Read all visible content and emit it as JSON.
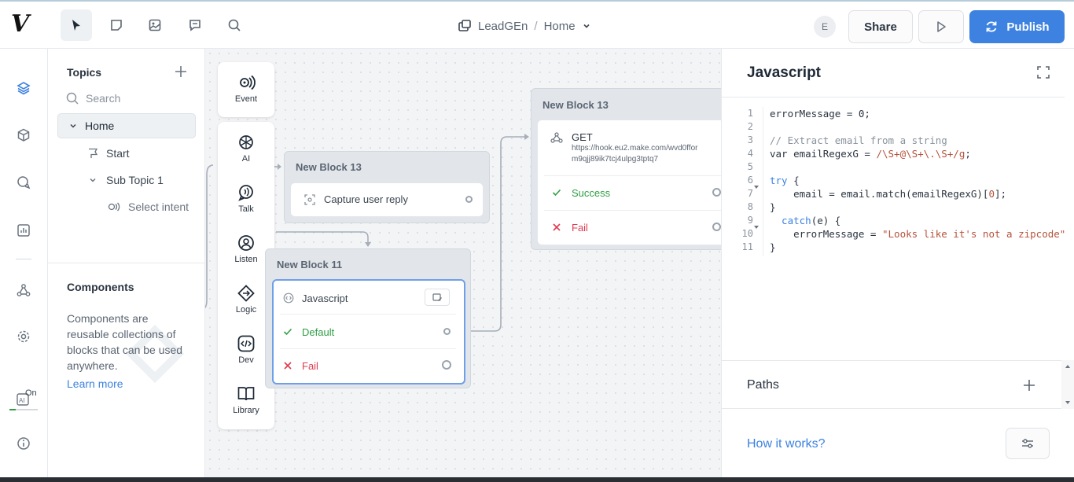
{
  "app": {
    "logo_text": "V"
  },
  "header": {
    "project": "LeadGEn",
    "separator": "/",
    "page": "Home",
    "avatar_initial": "E",
    "share_label": "Share",
    "publish_label": "Publish"
  },
  "rail": {
    "ai_toggle_label": "On"
  },
  "topics": {
    "title": "Topics",
    "search_placeholder": "Search",
    "items": [
      {
        "label": "Home"
      },
      {
        "label": "Start"
      },
      {
        "label": "Sub Topic 1"
      },
      {
        "label": "Select intent"
      }
    ]
  },
  "components": {
    "title": "Components",
    "description": "Components are reusable collections of blocks that can be used anywhere.",
    "learn_more": "Learn more"
  },
  "palette": {
    "event": "Event",
    "items": [
      "AI",
      "Talk",
      "Listen",
      "Logic",
      "Dev",
      "Library"
    ]
  },
  "blocks": {
    "block_a": {
      "title": "New Block 13",
      "step": "Capture user reply"
    },
    "block_b": {
      "title": "New Block 11",
      "step": "Javascript",
      "default_label": "Default",
      "fail_label": "Fail"
    },
    "block_c": {
      "title": "New Block 13",
      "method": "GET",
      "url_line1": "https://hook.eu2.make.com/wvd0ffor",
      "url_line2": "m9qjj89ik7tcj4ulpg3tptq7",
      "success_label": "Success",
      "fail_label": "Fail"
    }
  },
  "editor": {
    "title": "Javascript",
    "line_numbers": [
      "1",
      "2",
      "3",
      "4",
      "5",
      "6",
      "7",
      "8",
      "9",
      "10",
      "11"
    ],
    "lines": {
      "l1": "errorMessage = 0;",
      "l3": "// Extract email from a string",
      "l4a": "var emailRegexG = ",
      "l4b": "/\\S+@\\S+\\.\\S+/g",
      "l4c": ";",
      "l6a": "try",
      "l6b": " {",
      "l7a": "    email = email.match(emailRegexG)[",
      "l7b": "0",
      "l7c": "];",
      "l8": "}",
      "l9a": "  catch",
      "l9b": "(e) {",
      "l10a": "    errorMessage = ",
      "l10b": "\"Looks like it's not a zipcode\"",
      "l11": "}"
    }
  },
  "paths": {
    "label": "Paths"
  },
  "help": {
    "label": "How it works?"
  },
  "colors": {
    "accent": "#3d82e0",
    "success": "#2f9e44",
    "fail": "#e03a4f"
  }
}
